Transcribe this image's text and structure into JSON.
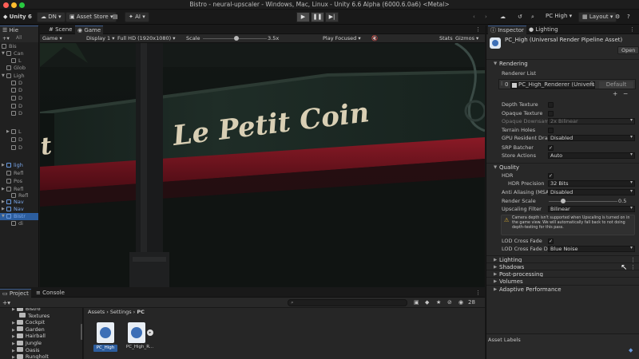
{
  "window": {
    "title": "Bistro - neural-upscaler - Windows, Mac, Linux - Unity 6.6 Alpha (6000.6.0a6) <Metal>"
  },
  "toolbar": {
    "app_label": "Unity 6",
    "account_label": "DN",
    "asset_store_label": "Asset Store",
    "ai_label": "AI",
    "quality_label": "PC High",
    "layout_label": "Layout"
  },
  "hierarchy": {
    "tab_label": "Hie",
    "search_label": "All",
    "items": [
      "Bis",
      "Can",
      "L",
      "Glob",
      "Ligh",
      "D",
      "D",
      "D",
      "D",
      "D",
      "L",
      "D",
      "D",
      "ligh",
      "Refl",
      "Pos",
      "Refl",
      "Refl",
      "Nav",
      "Nav",
      "Bistr",
      "di"
    ]
  },
  "scene_tab": "Scene",
  "game_tab": "Game",
  "game_bar": {
    "mode": "Game",
    "display": "Display 1",
    "resolution": "Full HD (1920x1080)",
    "scale_label": "Scale",
    "scale_value": "3.5x",
    "focus_mode": "Play Focused",
    "stats_label": "Stats",
    "gizmos_label": "Gizmos"
  },
  "viewport": {
    "sign_text": "Le Petit Coin",
    "edge_letter": "t"
  },
  "inspector": {
    "tab_inspector": "Inspector",
    "tab_lighting": "Lighting",
    "asset_title": "PC_High (Universal Render Pipeline Asset)",
    "open_label": "Open",
    "rendering": {
      "title": "Rendering",
      "renderer_list_label": "Renderer List",
      "renderer_index": "0",
      "renderer_name": "PC_High_Renderer (Universal",
      "default_label": "Default",
      "plus": "+",
      "minus": "−",
      "depth_texture": "Depth Texture",
      "opaque_texture": "Opaque Texture",
      "opaque_downsampling": "Opaque Downsamp",
      "opaque_downsampling_value": "2x Bilinear",
      "terrain_holes": "Terrain Holes",
      "gpu_resident_drawer": "GPU Resident Draw",
      "gpu_resident_drawer_value": "Disabled",
      "srp_batcher": "SRP Batcher",
      "store_actions": "Store Actions",
      "store_actions_value": "Auto"
    },
    "quality": {
      "title": "Quality",
      "hdr": "HDR",
      "hdr_precision": "HDR Precision",
      "hdr_precision_value": "32 Bits",
      "anti_aliasing": "Anti Aliasing (MSAA",
      "anti_aliasing_value": "Disabled",
      "render_scale": "Render Scale",
      "render_scale_value": 0.5,
      "render_scale_text": "0.5",
      "upscaling_filter": "Upscaling Filter",
      "upscaling_filter_value": "Bilinear",
      "warning": "Camera depth isn't supported when Upscaling is turned on in the game view. We will automatically fall back to not doing depth-testing for this pass.",
      "lod_cross_fade": "LOD Cross Fade",
      "lod_cross_fade_dither": "LOD Cross Fade Di",
      "lod_cross_fade_dither_value": "Blue Noise"
    },
    "sections": [
      "Lighting",
      "Shadows",
      "Post-processing",
      "Volumes",
      "Adaptive Performance"
    ],
    "asset_labels": "Asset Labels"
  },
  "project": {
    "tab_project": "Project",
    "tab_console": "Console",
    "breadcrumb": [
      "Assets",
      "Settings",
      "PC"
    ],
    "visible_count": "28",
    "tree": [
      {
        "label": "Bistro",
        "indent": 1
      },
      {
        "label": "Textures",
        "indent": 2
      },
      {
        "label": "Cockpit",
        "indent": 1
      },
      {
        "label": "Garden",
        "indent": 1
      },
      {
        "label": "Hairball",
        "indent": 1
      },
      {
        "label": "Jungle",
        "indent": 1
      },
      {
        "label": "Oasis",
        "indent": 1
      },
      {
        "label": "Rungholt",
        "indent": 1
      }
    ],
    "assets": [
      "PC_High",
      "PC_High_R..."
    ]
  },
  "colors": {
    "accent": "#3d6fb6",
    "sign_text": "#d9cfb4",
    "sign_board": "#1d2b25",
    "awning": "#7a1420",
    "play_active": "#3a3a3a"
  }
}
